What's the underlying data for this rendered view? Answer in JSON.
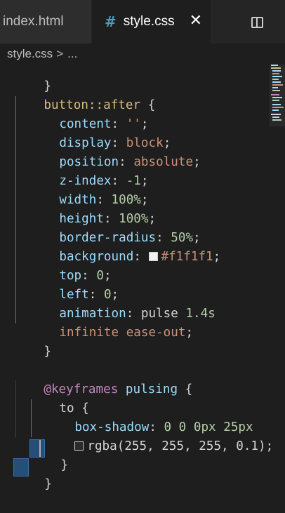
{
  "tabs": [
    {
      "label": "index.html",
      "active": false
    },
    {
      "label": "style.css",
      "active": true,
      "icon": "#"
    }
  ],
  "tab_close_glyph": "✕",
  "more_glyph": "...",
  "breadcrumb": {
    "file": "style.css",
    "separator": ">",
    "tail": "..."
  },
  "code": {
    "l0": "}",
    "l1_sel": "button::after",
    "l1_brace": " {",
    "l2_prop": "content",
    "l2_val": "''",
    "l3_prop": "display",
    "l3_val": "block",
    "l4_prop": "position",
    "l4_val": "absolute",
    "l5_prop": "z-index",
    "l5_val": "-1",
    "l6_prop": "width",
    "l6_val": "100%",
    "l7_prop": "height",
    "l7_val": "100%",
    "l8_prop": "border-radius",
    "l8_val": "50%",
    "l9_prop": "background",
    "l9_val": "#f1f1f1",
    "l10_prop": "top",
    "l10_val": "0",
    "l11_prop": "left",
    "l11_val": "0",
    "l12_prop": "animation",
    "l12_val1": "pulse",
    "l12_val2": "1.4s",
    "l13_val": "infinite ease-out",
    "l14": "}",
    "l16_at": "@keyframes",
    "l16_name": " pulsing",
    "l16_brace": " {",
    "l17_sel": "to",
    "l17_brace": " {",
    "l18_prop": "box-shadow",
    "l18_val": "0 0 0px 25px",
    "l19_val": "rgba(255, 255, 255, 0.1)",
    "l20": "}",
    "l21": "}"
  },
  "colors": {
    "swatch_background": "#f1f1f1",
    "swatch_shadow": "#2b2b2b",
    "selector": "#d7ba7d",
    "property": "#9cdcfe",
    "string_value": "#ce9178",
    "number": "#b5cea8",
    "at_rule": "#c586c0"
  }
}
